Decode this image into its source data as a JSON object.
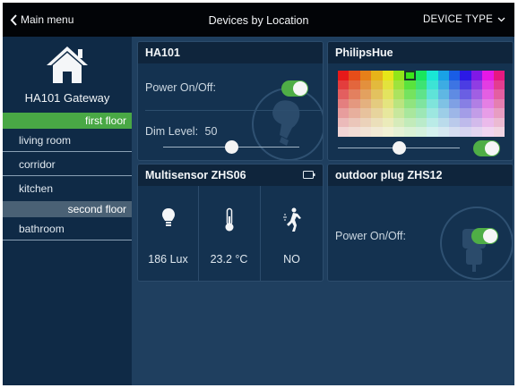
{
  "topbar": {
    "back_label": "Main menu",
    "title": "Devices by Location",
    "device_type_label": "DEVICE TYPE"
  },
  "sidebar": {
    "gateway_name": "HA101 Gateway",
    "floors": [
      {
        "label": "first floor",
        "rooms": [
          "living room",
          "corridor",
          "kitchen"
        ]
      },
      {
        "label": "second floor",
        "rooms": [
          "bathroom"
        ]
      }
    ]
  },
  "panels": {
    "ha101": {
      "title": "HA101",
      "power_label": "Power On/Off:",
      "power_on": true,
      "dim_label": "Dim Level:",
      "dim_value": "50",
      "dim_fraction": 0.5
    },
    "philips": {
      "title": "PhilipsHue",
      "brightness_fraction": 0.5,
      "power_on": true,
      "selected_color": "#5fc45a"
    },
    "multisensor": {
      "title": "Multisensor ZHS06",
      "lux": "186 Lux",
      "temperature": "23.2 °C",
      "motion": "NO"
    },
    "outdoor": {
      "title": "outdoor plug ZHS12",
      "power_label": "Power On/Off:",
      "power_on": true
    }
  },
  "colors": {
    "accent_green": "#49a845",
    "background": "#1f3f5f",
    "panel_bg": "#143250",
    "topbar_bg": "#020407"
  }
}
